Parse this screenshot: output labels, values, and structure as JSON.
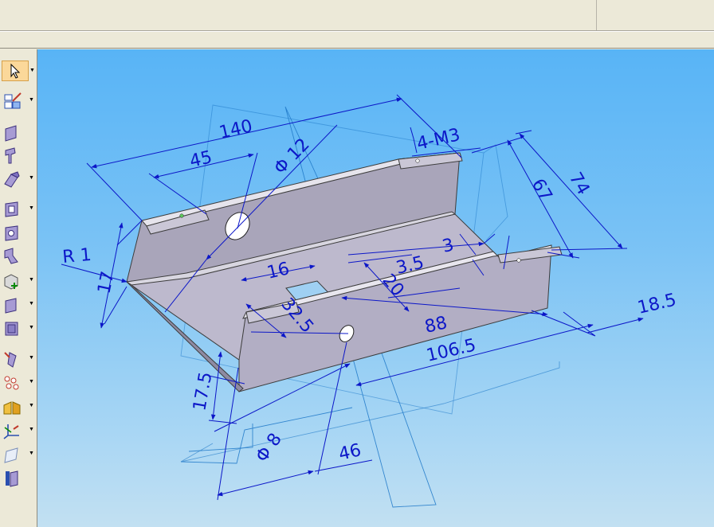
{
  "app": {
    "accent": "#0c17c8",
    "selected_tool_color": "#fbd89a"
  },
  "toolbar": {
    "tools": [
      {
        "icon": "select-arrow-icon",
        "has_dropdown": true,
        "active": true
      },
      {
        "icon": "sketch-edit-icon",
        "has_dropdown": true
      },
      {
        "icon": "tab-icon",
        "has_dropdown": false
      },
      {
        "icon": "flange-icon",
        "has_dropdown": false
      },
      {
        "icon": "contour-flange-icon",
        "has_dropdown": true
      },
      {
        "icon": "cutout-icon",
        "has_dropdown": true
      },
      {
        "icon": "hole-icon",
        "has_dropdown": false
      },
      {
        "icon": "bend-icon",
        "has_dropdown": false
      },
      {
        "icon": "insert-corner-icon",
        "has_dropdown": true
      },
      {
        "icon": "thicken-icon",
        "has_dropdown": true
      },
      {
        "icon": "plate-icon",
        "has_dropdown": true
      },
      {
        "icon": "dimple-icon",
        "has_dropdown": true
      },
      {
        "icon": "pattern-icon",
        "has_dropdown": true
      },
      {
        "icon": "mirror-icon",
        "has_dropdown": true
      },
      {
        "icon": "coordinate-system-icon",
        "has_dropdown": true
      },
      {
        "icon": "reference-plane-icon",
        "has_dropdown": true
      },
      {
        "icon": "part-view-icon",
        "has_dropdown": false
      }
    ]
  },
  "drawing": {
    "dimensions": [
      {
        "id": "d140",
        "text": "140"
      },
      {
        "id": "d45",
        "text": "45"
      },
      {
        "id": "d12",
        "text": "Φ 12"
      },
      {
        "id": "dm3",
        "text": "4-M3"
      },
      {
        "id": "d67",
        "text": "67"
      },
      {
        "id": "d74",
        "text": "74"
      },
      {
        "id": "dr1",
        "text": "R 1"
      },
      {
        "id": "d17",
        "text": "17"
      },
      {
        "id": "d16",
        "text": "16"
      },
      {
        "id": "d35",
        "text": "3.5"
      },
      {
        "id": "d3",
        "text": "3"
      },
      {
        "id": "d20",
        "text": "20"
      },
      {
        "id": "d325",
        "text": "32.5"
      },
      {
        "id": "d88",
        "text": "88"
      },
      {
        "id": "d1065",
        "text": "106.5"
      },
      {
        "id": "d185",
        "text": "18.5"
      },
      {
        "id": "d175",
        "text": "17.5"
      },
      {
        "id": "d8",
        "text": "Φ 8"
      },
      {
        "id": "d46",
        "text": "46"
      }
    ]
  }
}
